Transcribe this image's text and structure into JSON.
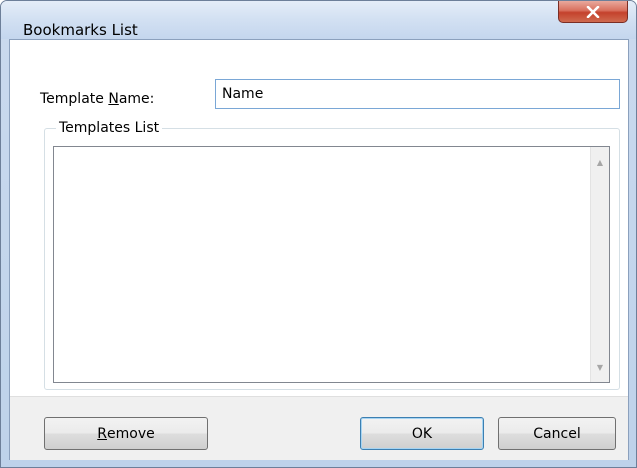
{
  "window": {
    "title": "Bookmarks List"
  },
  "form": {
    "template_name_label_prefix": "Template ",
    "template_name_label_accel": "N",
    "template_name_label_suffix": "ame:",
    "template_name_value": "Name"
  },
  "group": {
    "legend": "Templates List",
    "items": []
  },
  "buttons": {
    "remove_accel": "R",
    "remove_rest": "emove",
    "ok": "OK",
    "cancel": "Cancel"
  },
  "icons": {
    "close": "close-icon",
    "scroll_up": "scroll-up-arrow-icon",
    "scroll_down": "scroll-down-arrow-icon"
  },
  "colors": {
    "close_button": "#c4412c",
    "input_border": "#7aa7d6",
    "default_button_border": "#3c7fb1"
  }
}
